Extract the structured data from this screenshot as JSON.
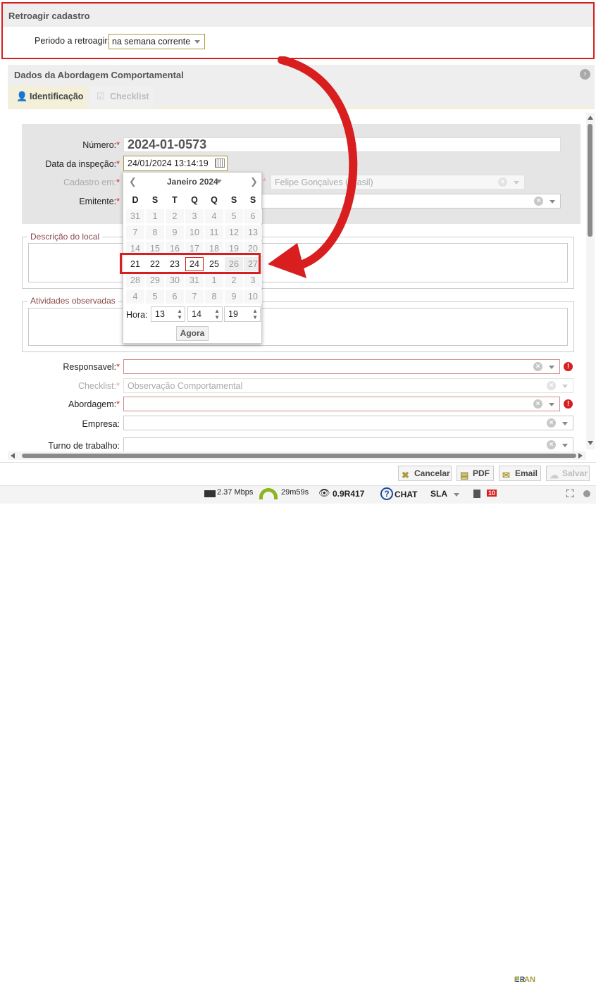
{
  "retro": {
    "title": "Retroagir cadastro",
    "period_label": "Periodo a retroagir:",
    "period_value": "na semana corrente"
  },
  "panel": {
    "title": "Dados da Abordagem Comportamental"
  },
  "tabs": [
    {
      "label": "Identificação"
    },
    {
      "label": "Checklist"
    }
  ],
  "form": {
    "numero_label": "Número:",
    "numero_value": "2024-01-0573",
    "data_label": "Data da inspeção:",
    "data_value": "24/01/2024 13:14:19",
    "cadastro_label": "Cadastro em:",
    "cadastro_value": "Felipe Gonçalves (Brasil)",
    "emitente_label": "Emitente:",
    "descricao_label": "Descrição do local",
    "atividades_label": "Atividades observadas",
    "responsavel_label": "Responsavel:",
    "checklist_label": "Checklist:",
    "checklist_value": "Observação Comportamental",
    "abordagem_label": "Abordagem:",
    "empresa_label": "Empresa:",
    "turno_label": "Turno de trabalho:",
    "required_star": "*"
  },
  "calendar": {
    "month_label": "Janeiro 2024",
    "weekdays": [
      "D",
      "S",
      "T",
      "Q",
      "Q",
      "S",
      "S"
    ],
    "weeks": [
      [
        "31",
        "1",
        "2",
        "3",
        "4",
        "5",
        "6"
      ],
      [
        "7",
        "8",
        "9",
        "10",
        "11",
        "12",
        "13"
      ],
      [
        "14",
        "15",
        "16",
        "17",
        "18",
        "19",
        "20"
      ],
      [
        "21",
        "22",
        "23",
        "24",
        "25",
        "26",
        "27"
      ],
      [
        "28",
        "29",
        "30",
        "31",
        "1",
        "2",
        "3"
      ],
      [
        "4",
        "5",
        "6",
        "7",
        "8",
        "9",
        "10"
      ]
    ],
    "hour_label": "Hora:",
    "hour": "13",
    "minute": "14",
    "second": "19",
    "now_label": "Agora"
  },
  "actions": {
    "cancel": "Cancelar",
    "pdf": "PDF",
    "email": "Email",
    "save": "Salvar"
  },
  "status": {
    "speed": "2.37 Mbps",
    "timer": "29m59s",
    "version": "0.9R417",
    "chat": "CHAT",
    "sla": "SLA",
    "badge": "10",
    "brand1": "ER",
    "brand2": "PLAN"
  },
  "colors": {
    "highlight_red": "#d81e1e",
    "tab_active_bg": "#f3efd9",
    "accent_olive": "#a89a3a",
    "timer_green": "#8bb51c"
  }
}
